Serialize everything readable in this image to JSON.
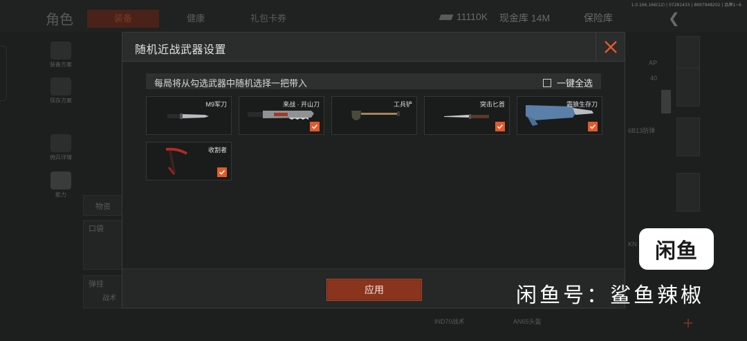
{
  "background": {
    "title": "角色",
    "tabs": [
      "装备",
      "健康",
      "礼包卡券"
    ],
    "coins": "11110K",
    "cash_store": "现金库 14M",
    "vault": "保险库",
    "version": "1.0.166.166(12) | 07281433 | 8997948202 | 品牌1~6",
    "sidebar": [
      "装备方案",
      "保存方案",
      "佣兵详情",
      "能力"
    ],
    "items_label": "物资",
    "pocket_label": "口袋",
    "ammo_label": "弹挂",
    "tactical_label": "战术",
    "right_labels": [
      "AP",
      "40",
      "6B13防弹",
      "KN"
    ],
    "bottom_labels": [
      "IND70战术",
      "AN65头盔"
    ]
  },
  "modal": {
    "title": "随机近战武器设置",
    "info_text": "每局将从勾选武器中随机选择一把带入",
    "select_all": "一键全选",
    "apply": "应用",
    "weapons": [
      {
        "name": "M9军刀",
        "checked": false,
        "icon": "combat-knife"
      },
      {
        "name": "来战 · 开山刀",
        "checked": true,
        "icon": "machete"
      },
      {
        "name": "工兵铲",
        "checked": false,
        "icon": "shovel"
      },
      {
        "name": "突击匕首",
        "checked": true,
        "icon": "dagger"
      },
      {
        "name": "霜狼生存刀",
        "checked": true,
        "icon": "survival-knife"
      },
      {
        "name": "收割者",
        "checked": true,
        "icon": "reaper-sickle"
      }
    ]
  },
  "watermark": {
    "logo": "闲鱼",
    "handle": "闲鱼号：鲨鱼辣椒"
  },
  "colors": {
    "accent": "#e25a2b",
    "apply_button": "#8a341e"
  }
}
